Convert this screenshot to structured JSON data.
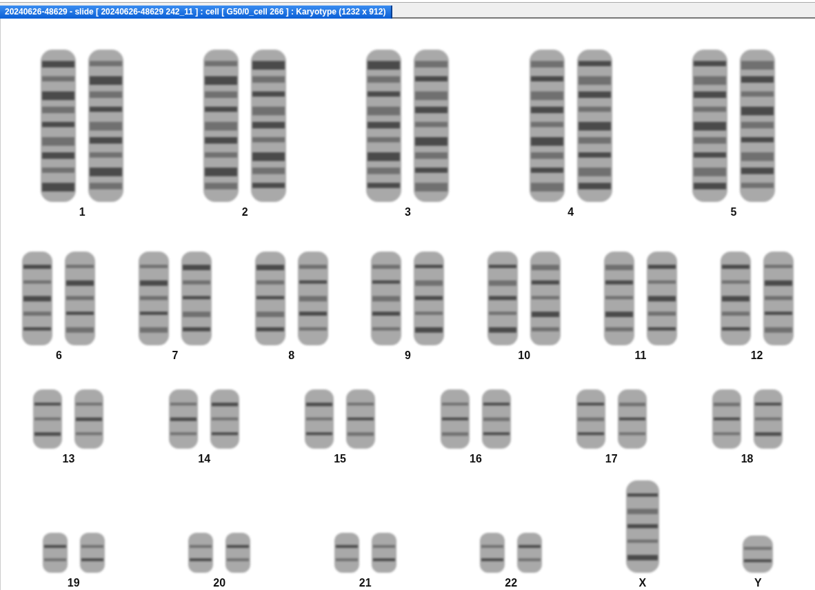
{
  "window": {
    "title": "20240626-48629 - slide [ 20240626-48629 242_11 ] : cell [ G50/0_cell 266 ] : Karyotype  (1232 x 912)"
  },
  "karyotype": {
    "rows": [
      {
        "items": [
          {
            "label": "1",
            "kind": "pair"
          },
          {
            "label": "2",
            "kind": "pair"
          },
          {
            "label": "3",
            "kind": "pair"
          },
          {
            "label": "4",
            "kind": "pair"
          },
          {
            "label": "5",
            "kind": "pair"
          }
        ]
      },
      {
        "items": [
          {
            "label": "6",
            "kind": "pair"
          },
          {
            "label": "7",
            "kind": "pair"
          },
          {
            "label": "8",
            "kind": "pair"
          },
          {
            "label": "9",
            "kind": "pair"
          },
          {
            "label": "10",
            "kind": "pair"
          },
          {
            "label": "11",
            "kind": "pair"
          },
          {
            "label": "12",
            "kind": "pair"
          }
        ]
      },
      {
        "items": [
          {
            "label": "13",
            "kind": "pair"
          },
          {
            "label": "14",
            "kind": "pair"
          },
          {
            "label": "15",
            "kind": "pair"
          },
          {
            "label": "16",
            "kind": "pair"
          },
          {
            "label": "17",
            "kind": "pair"
          },
          {
            "label": "18",
            "kind": "pair"
          }
        ]
      },
      {
        "items": [
          {
            "label": "19",
            "kind": "pair"
          },
          {
            "label": "20",
            "kind": "pair"
          },
          {
            "label": "21",
            "kind": "pair"
          },
          {
            "label": "22",
            "kind": "pair"
          },
          {
            "label": "X",
            "kind": "tall-single"
          },
          {
            "label": "Y",
            "kind": "short-single"
          }
        ]
      }
    ]
  }
}
